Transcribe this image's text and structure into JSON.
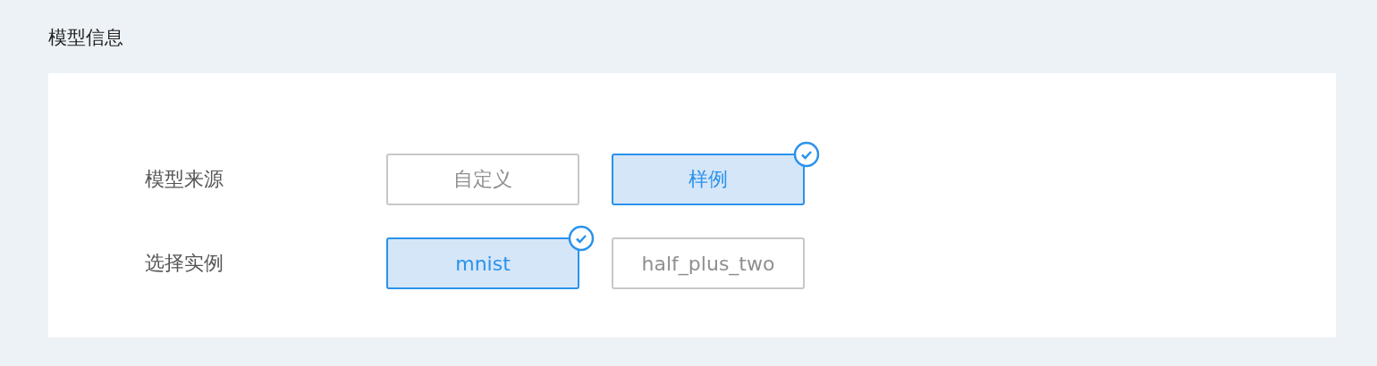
{
  "section": {
    "title": "模型信息"
  },
  "fields": [
    {
      "label": "模型来源",
      "options": [
        {
          "label": "自定义",
          "selected": false
        },
        {
          "label": "样例",
          "selected": true
        }
      ]
    },
    {
      "label": "选择实例",
      "options": [
        {
          "label": "mnist",
          "selected": true
        },
        {
          "label": "half_plus_two",
          "selected": false
        }
      ]
    }
  ]
}
